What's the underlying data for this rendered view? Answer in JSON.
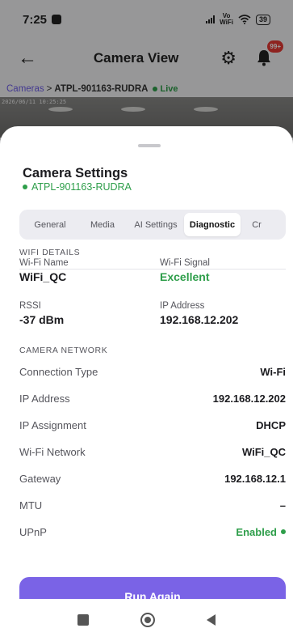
{
  "status_bar": {
    "time": "7:25",
    "volte_top": "Vo",
    "volte_bottom": "WiFi",
    "battery": "39"
  },
  "header": {
    "title": "Camera View",
    "notification_badge": "99+"
  },
  "breadcrumb": {
    "root": "Cameras",
    "separator": ">",
    "camera": "ATPL-901163-RUDRA",
    "live": "Live"
  },
  "feed": {
    "timestamp": "2026/06/11 10:25:25"
  },
  "sheet": {
    "title": "Camera Settings",
    "subtitle": "ATPL-901163-RUDRA",
    "tabs": [
      {
        "label": "General"
      },
      {
        "label": "Media"
      },
      {
        "label": "AI Settings"
      },
      {
        "label": "Diagnostic"
      },
      {
        "label": "Cr"
      }
    ],
    "active_tab": "Diagnostic",
    "wifi_details": {
      "heading": "WIFI DETAILS",
      "wifi_name_label": "Wi-Fi Name",
      "wifi_name": "WiFi_QC",
      "wifi_signal_label": "Wi-Fi Signal",
      "wifi_signal": "Excellent",
      "rssi_label": "RSSI",
      "rssi": "-37 dBm",
      "ip_label": "IP Address",
      "ip": "192.168.12.202"
    },
    "camera_network": {
      "heading": "CAMERA NETWORK",
      "rows": [
        {
          "label": "Connection Type",
          "value": "Wi-Fi"
        },
        {
          "label": "IP Address",
          "value": "192.168.12.202"
        },
        {
          "label": "IP Assignment",
          "value": "DHCP"
        },
        {
          "label": "Wi-Fi Network",
          "value": "WiFi_QC"
        },
        {
          "label": "Gateway",
          "value": "192.168.12.1"
        },
        {
          "label": "MTU",
          "value": "–"
        },
        {
          "label": "UPnP",
          "value": "Enabled"
        }
      ]
    },
    "run_button": "Run Again"
  },
  "colors": {
    "accent": "#7a63e6",
    "good": "#2e9e4a",
    "badge": "#e53935"
  },
  "icons": [
    "back-arrow-icon",
    "gear-icon",
    "bell-icon",
    "live-dot-icon",
    "square-nav-icon",
    "home-circle-icon",
    "back-triangle-icon"
  ]
}
